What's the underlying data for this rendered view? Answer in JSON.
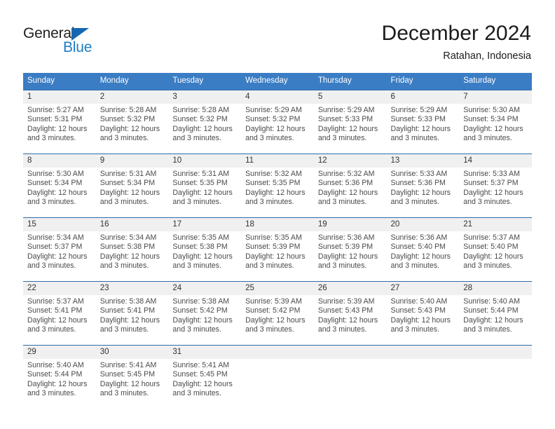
{
  "logo": {
    "word_one": "General",
    "word_two": "Blue",
    "triangle_color": "#1567b3",
    "blue_color": "#1f7ec4",
    "dark_color": "#231f20"
  },
  "header": {
    "title": "December 2024",
    "location": "Ratahan, Indonesia"
  },
  "theme": {
    "header_bg": "#3b7dc4",
    "row_divider": "#2e6da8",
    "daynum_bg": "#f0f0f0",
    "text": "#4a4a4a"
  },
  "weekdays": [
    "Sunday",
    "Monday",
    "Tuesday",
    "Wednesday",
    "Thursday",
    "Friday",
    "Saturday"
  ],
  "labels": {
    "sunrise_prefix": "Sunrise:",
    "sunset_prefix": "Sunset:",
    "daylight_prefix": "Daylight:"
  },
  "weeks": [
    [
      {
        "day": "1",
        "sunrise": "Sunrise: 5:27 AM",
        "sunset": "Sunset: 5:31 PM",
        "daylight1": "Daylight: 12 hours",
        "daylight2": "and 3 minutes."
      },
      {
        "day": "2",
        "sunrise": "Sunrise: 5:28 AM",
        "sunset": "Sunset: 5:32 PM",
        "daylight1": "Daylight: 12 hours",
        "daylight2": "and 3 minutes."
      },
      {
        "day": "3",
        "sunrise": "Sunrise: 5:28 AM",
        "sunset": "Sunset: 5:32 PM",
        "daylight1": "Daylight: 12 hours",
        "daylight2": "and 3 minutes."
      },
      {
        "day": "4",
        "sunrise": "Sunrise: 5:29 AM",
        "sunset": "Sunset: 5:32 PM",
        "daylight1": "Daylight: 12 hours",
        "daylight2": "and 3 minutes."
      },
      {
        "day": "5",
        "sunrise": "Sunrise: 5:29 AM",
        "sunset": "Sunset: 5:33 PM",
        "daylight1": "Daylight: 12 hours",
        "daylight2": "and 3 minutes."
      },
      {
        "day": "6",
        "sunrise": "Sunrise: 5:29 AM",
        "sunset": "Sunset: 5:33 PM",
        "daylight1": "Daylight: 12 hours",
        "daylight2": "and 3 minutes."
      },
      {
        "day": "7",
        "sunrise": "Sunrise: 5:30 AM",
        "sunset": "Sunset: 5:34 PM",
        "daylight1": "Daylight: 12 hours",
        "daylight2": "and 3 minutes."
      }
    ],
    [
      {
        "day": "8",
        "sunrise": "Sunrise: 5:30 AM",
        "sunset": "Sunset: 5:34 PM",
        "daylight1": "Daylight: 12 hours",
        "daylight2": "and 3 minutes."
      },
      {
        "day": "9",
        "sunrise": "Sunrise: 5:31 AM",
        "sunset": "Sunset: 5:34 PM",
        "daylight1": "Daylight: 12 hours",
        "daylight2": "and 3 minutes."
      },
      {
        "day": "10",
        "sunrise": "Sunrise: 5:31 AM",
        "sunset": "Sunset: 5:35 PM",
        "daylight1": "Daylight: 12 hours",
        "daylight2": "and 3 minutes."
      },
      {
        "day": "11",
        "sunrise": "Sunrise: 5:32 AM",
        "sunset": "Sunset: 5:35 PM",
        "daylight1": "Daylight: 12 hours",
        "daylight2": "and 3 minutes."
      },
      {
        "day": "12",
        "sunrise": "Sunrise: 5:32 AM",
        "sunset": "Sunset: 5:36 PM",
        "daylight1": "Daylight: 12 hours",
        "daylight2": "and 3 minutes."
      },
      {
        "day": "13",
        "sunrise": "Sunrise: 5:33 AM",
        "sunset": "Sunset: 5:36 PM",
        "daylight1": "Daylight: 12 hours",
        "daylight2": "and 3 minutes."
      },
      {
        "day": "14",
        "sunrise": "Sunrise: 5:33 AM",
        "sunset": "Sunset: 5:37 PM",
        "daylight1": "Daylight: 12 hours",
        "daylight2": "and 3 minutes."
      }
    ],
    [
      {
        "day": "15",
        "sunrise": "Sunrise: 5:34 AM",
        "sunset": "Sunset: 5:37 PM",
        "daylight1": "Daylight: 12 hours",
        "daylight2": "and 3 minutes."
      },
      {
        "day": "16",
        "sunrise": "Sunrise: 5:34 AM",
        "sunset": "Sunset: 5:38 PM",
        "daylight1": "Daylight: 12 hours",
        "daylight2": "and 3 minutes."
      },
      {
        "day": "17",
        "sunrise": "Sunrise: 5:35 AM",
        "sunset": "Sunset: 5:38 PM",
        "daylight1": "Daylight: 12 hours",
        "daylight2": "and 3 minutes."
      },
      {
        "day": "18",
        "sunrise": "Sunrise: 5:35 AM",
        "sunset": "Sunset: 5:39 PM",
        "daylight1": "Daylight: 12 hours",
        "daylight2": "and 3 minutes."
      },
      {
        "day": "19",
        "sunrise": "Sunrise: 5:36 AM",
        "sunset": "Sunset: 5:39 PM",
        "daylight1": "Daylight: 12 hours",
        "daylight2": "and 3 minutes."
      },
      {
        "day": "20",
        "sunrise": "Sunrise: 5:36 AM",
        "sunset": "Sunset: 5:40 PM",
        "daylight1": "Daylight: 12 hours",
        "daylight2": "and 3 minutes."
      },
      {
        "day": "21",
        "sunrise": "Sunrise: 5:37 AM",
        "sunset": "Sunset: 5:40 PM",
        "daylight1": "Daylight: 12 hours",
        "daylight2": "and 3 minutes."
      }
    ],
    [
      {
        "day": "22",
        "sunrise": "Sunrise: 5:37 AM",
        "sunset": "Sunset: 5:41 PM",
        "daylight1": "Daylight: 12 hours",
        "daylight2": "and 3 minutes."
      },
      {
        "day": "23",
        "sunrise": "Sunrise: 5:38 AM",
        "sunset": "Sunset: 5:41 PM",
        "daylight1": "Daylight: 12 hours",
        "daylight2": "and 3 minutes."
      },
      {
        "day": "24",
        "sunrise": "Sunrise: 5:38 AM",
        "sunset": "Sunset: 5:42 PM",
        "daylight1": "Daylight: 12 hours",
        "daylight2": "and 3 minutes."
      },
      {
        "day": "25",
        "sunrise": "Sunrise: 5:39 AM",
        "sunset": "Sunset: 5:42 PM",
        "daylight1": "Daylight: 12 hours",
        "daylight2": "and 3 minutes."
      },
      {
        "day": "26",
        "sunrise": "Sunrise: 5:39 AM",
        "sunset": "Sunset: 5:43 PM",
        "daylight1": "Daylight: 12 hours",
        "daylight2": "and 3 minutes."
      },
      {
        "day": "27",
        "sunrise": "Sunrise: 5:40 AM",
        "sunset": "Sunset: 5:43 PM",
        "daylight1": "Daylight: 12 hours",
        "daylight2": "and 3 minutes."
      },
      {
        "day": "28",
        "sunrise": "Sunrise: 5:40 AM",
        "sunset": "Sunset: 5:44 PM",
        "daylight1": "Daylight: 12 hours",
        "daylight2": "and 3 minutes."
      }
    ],
    [
      {
        "day": "29",
        "sunrise": "Sunrise: 5:40 AM",
        "sunset": "Sunset: 5:44 PM",
        "daylight1": "Daylight: 12 hours",
        "daylight2": "and 3 minutes."
      },
      {
        "day": "30",
        "sunrise": "Sunrise: 5:41 AM",
        "sunset": "Sunset: 5:45 PM",
        "daylight1": "Daylight: 12 hours",
        "daylight2": "and 3 minutes."
      },
      {
        "day": "31",
        "sunrise": "Sunrise: 5:41 AM",
        "sunset": "Sunset: 5:45 PM",
        "daylight1": "Daylight: 12 hours",
        "daylight2": "and 3 minutes."
      },
      {
        "day": "",
        "sunrise": "",
        "sunset": "",
        "daylight1": "",
        "daylight2": ""
      },
      {
        "day": "",
        "sunrise": "",
        "sunset": "",
        "daylight1": "",
        "daylight2": ""
      },
      {
        "day": "",
        "sunrise": "",
        "sunset": "",
        "daylight1": "",
        "daylight2": ""
      },
      {
        "day": "",
        "sunrise": "",
        "sunset": "",
        "daylight1": "",
        "daylight2": ""
      }
    ]
  ]
}
